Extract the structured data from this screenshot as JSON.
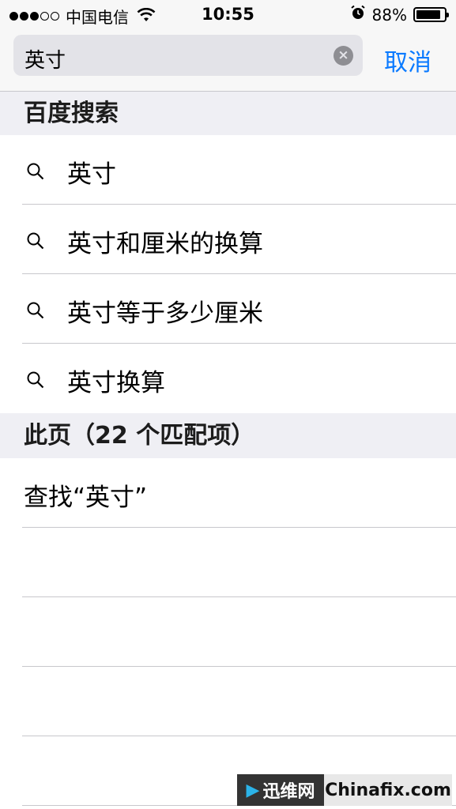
{
  "status_bar": {
    "signal_dots_filled": 3,
    "signal_dots_empty": 2,
    "carrier": "中国电信",
    "time": "10:55",
    "battery_percent": "88%",
    "battery_level": 0.88,
    "icons": [
      "wifi-icon",
      "alarm-icon",
      "battery-icon"
    ]
  },
  "search": {
    "query": "英寸",
    "cancel_label": "取消"
  },
  "sections": {
    "baidu_header": "百度搜索",
    "suggestions": [
      {
        "label": "英寸"
      },
      {
        "label": "英寸和厘米的换算"
      },
      {
        "label": "英寸等于多少厘米"
      },
      {
        "label": "英寸换算"
      }
    ],
    "page_header": "此页（22 个匹配项）",
    "find_label": "查找“英寸”"
  },
  "watermark": {
    "left_text": "迅维网",
    "right_text": "Chinafix.com"
  },
  "colors": {
    "accent": "#0a7aff",
    "header_bg": "#efeff4",
    "separator": "#c8c7cc"
  }
}
